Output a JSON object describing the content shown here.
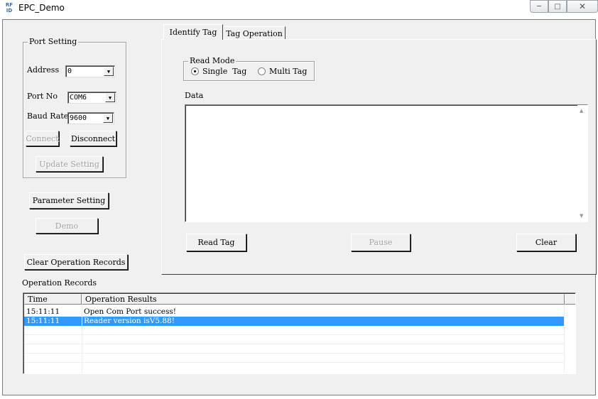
{
  "window": {
    "title": "EPC_Demo",
    "icon_text": "RF\nID",
    "minimize": "▭",
    "maximize": "▢",
    "close": "✕"
  },
  "port_setting": {
    "title": "Port Setting",
    "address_label": "Address",
    "address_value": "0",
    "port_label": "Port No",
    "port_value": "COM6",
    "baud_label": "Baud Rate",
    "baud_value": "9600",
    "connect": "Connect",
    "disconnect": "Disconnect",
    "update": "Update Setting"
  },
  "left_buttons": {
    "parameter": "Parameter Setting",
    "demo": "Demo",
    "clear_records": "Clear Operation Records"
  },
  "tabs": [
    {
      "label": "Identify Tag",
      "active": true
    },
    {
      "label": "Tag Operation",
      "active": false
    }
  ],
  "identify": {
    "read_mode_title": "Read Mode",
    "single_tag": "Single  Tag",
    "multi_tag": "Multi Tag",
    "data_label": "Data",
    "read_tag": "Read Tag",
    "pause": "Pause",
    "clear": "Clear"
  },
  "records": {
    "title": "Operation Records",
    "columns": [
      "Time",
      "Operation Results"
    ],
    "rows": [
      {
        "time": "15:11:11",
        "result": "Open Com Port success!"
      },
      {
        "time": "15:11:11",
        "result": "Reader version isV5.88!"
      }
    ]
  }
}
